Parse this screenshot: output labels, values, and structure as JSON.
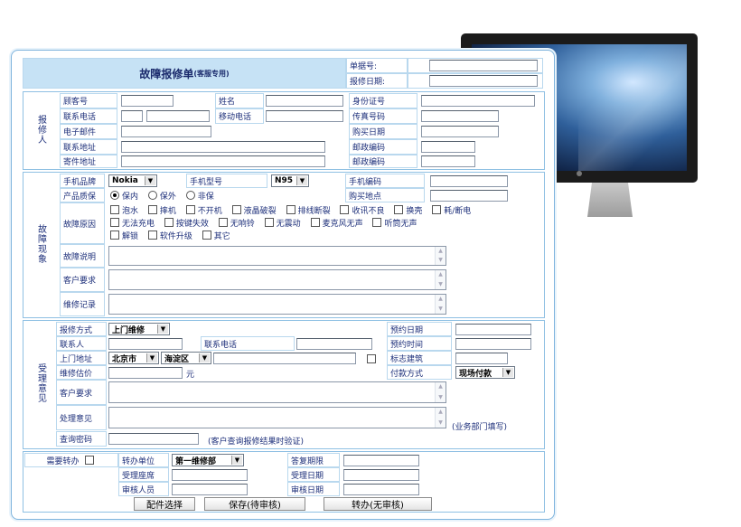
{
  "header": {
    "title": "故障报修单",
    "subtitle": "(客服专用)",
    "order_no_label": "单据号:",
    "repair_date_label": "报修日期:"
  },
  "reporter": {
    "section_label": "报修人",
    "customer_no": "顾客号",
    "name": "姓名",
    "id_no": "身份证号",
    "phone": "联系电话",
    "mobile": "移动电话",
    "fax": "传真号码",
    "email": "电子邮件",
    "purchase_date": "购买日期",
    "address": "联系地址",
    "postcode1": "邮政编码",
    "mail_address": "寄件地址",
    "postcode2": "邮政编码"
  },
  "fault": {
    "section_label": "故障现象",
    "brand_label": "手机品牌",
    "brand_value": "Nokia",
    "model_label": "手机型号",
    "model_value": "N95",
    "code_label": "手机编码",
    "warranty_label": "产品质保",
    "warranty_options": [
      "保内",
      "保外",
      "非保"
    ],
    "purchase_place": "购买地点",
    "cause_label": "故障原因",
    "causes_row1": [
      "泡水",
      "摔机",
      "不开机",
      "液晶破裂",
      "排线断裂",
      "收讯不良",
      "换壳",
      "耗/断电"
    ],
    "causes_row2": [
      "无法充电",
      "按键失效",
      "无响铃",
      "无震动",
      "麦克风无声",
      "听筒无声"
    ],
    "causes_row3": [
      "解锁",
      "软件升级",
      "其它"
    ],
    "desc_label": "故障说明",
    "request_label": "客户要求",
    "record_label": "维修记录"
  },
  "acceptance": {
    "section_label": "受理意见",
    "method_label": "报修方式",
    "method_value": "上门维修",
    "appoint_date": "预约日期",
    "contact": "联系人",
    "contact_phone": "联系电话",
    "appoint_time": "预约时间",
    "visit_address": "上门地址",
    "city": "北京市",
    "district": "海淀区",
    "landmark": "标志建筑",
    "estimate": "维修估价",
    "unit": "元",
    "pay_method": "付款方式",
    "pay_value": "现场付款",
    "request": "客户要求",
    "opinion": "处理意见",
    "dept_note": "(业务部门填写)",
    "password": "查询密码",
    "password_note": "(客户查询报修结果时验证)"
  },
  "footer": {
    "transfer_label": "需要转办",
    "dept_label": "转办单位",
    "dept_value": "第一维修部",
    "deadline": "答复期限",
    "seat": "受理座席",
    "accept_date": "受理日期",
    "reviewer": "审核人员",
    "review_date": "审核日期",
    "btn_parts": "配件选择",
    "btn_save": "保存(待审核)",
    "btn_transfer": "转办(无审核)"
  }
}
